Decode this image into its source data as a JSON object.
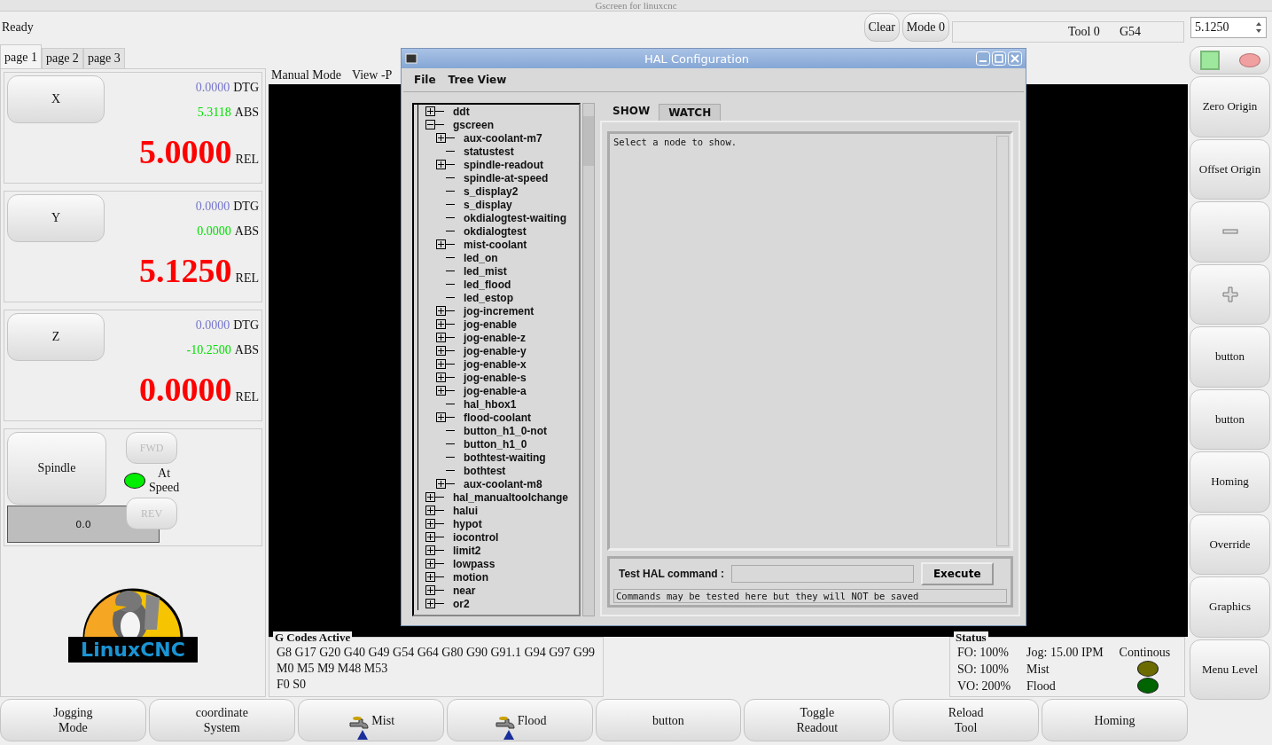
{
  "window": {
    "title": "Gscreen for linuxcnc"
  },
  "top_bar": {
    "status": "Ready",
    "buttons": [
      "Clear",
      "Mode 0"
    ],
    "tool": "Tool 0",
    "offset": "G54",
    "spin_value": "5.1250"
  },
  "tabs": [
    {
      "label": "page 1",
      "selected": true
    },
    {
      "label": "page 2",
      "selected": false
    },
    {
      "label": "page 3",
      "selected": false
    }
  ],
  "axes": [
    {
      "name": "X",
      "dtg": "0.0000",
      "dtg_label": "DTG",
      "abs": "5.3118",
      "abs_label": "ABS",
      "rel": "5.0000",
      "rel_label": "REL"
    },
    {
      "name": "Y",
      "dtg": "0.0000",
      "dtg_label": "DTG",
      "abs": "0.0000",
      "abs_label": "ABS",
      "rel": "5.1250",
      "rel_label": "REL"
    },
    {
      "name": "Z",
      "dtg": "0.0000",
      "dtg_label": "DTG",
      "abs": "-10.2500",
      "abs_label": "ABS",
      "rel": "0.0000",
      "rel_label": "REL"
    }
  ],
  "spindle": {
    "button": "Spindle",
    "fwd": {
      "label": "FWD",
      "disabled": true
    },
    "rev": {
      "label": "REV",
      "disabled": true
    },
    "at_speed_label": "At\nSpeed",
    "at_speed_led": {
      "color": "#00ee00"
    },
    "speed": "0.0"
  },
  "logo": {
    "text": "LinuxCNC"
  },
  "center": {
    "mode": "Manual Mode",
    "view": "View -P"
  },
  "gcodes": {
    "title": "G Codes Active",
    "lines": [
      "G8 G17 G20 G40 G49 G54 G64 G80 G90 G91.1 G94 G97 G99",
      "M0 M5 M9 M48 M53",
      "F0    S0"
    ]
  },
  "status": {
    "title": "Status",
    "fo": "FO: 100%",
    "jog": "Jog: 15.00 IPM",
    "jog_mode": "Continous",
    "so": "SO: 100%",
    "vo": "VO: 200%",
    "leds": [
      {
        "label": "Mist",
        "color": "#6b6b00"
      },
      {
        "label": "Flood",
        "color": "#006400"
      }
    ]
  },
  "right_buttons": [
    {
      "kind": "leds"
    },
    {
      "kind": "text",
      "label": "Zero Origin"
    },
    {
      "kind": "text",
      "label": "Offset Origin"
    },
    {
      "kind": "minus"
    },
    {
      "kind": "plus"
    },
    {
      "kind": "text",
      "label": "button"
    },
    {
      "kind": "text",
      "label": "button"
    },
    {
      "kind": "text",
      "label": "Homing"
    },
    {
      "kind": "text",
      "label": "Override"
    },
    {
      "kind": "text",
      "label": "Graphics"
    },
    {
      "kind": "text",
      "label": "Menu Level"
    }
  ],
  "bottom_buttons": [
    {
      "kind": "text",
      "label": "Jogging\nMode"
    },
    {
      "kind": "text",
      "label": "coordinate\nSystem"
    },
    {
      "kind": "tap",
      "label": "Mist"
    },
    {
      "kind": "tap",
      "label": "Flood"
    },
    {
      "kind": "text",
      "label": "button"
    },
    {
      "kind": "text",
      "label": "Toggle\nReadout"
    },
    {
      "kind": "text",
      "label": "Reload\nTool"
    },
    {
      "kind": "text",
      "label": "Homing"
    }
  ],
  "hal_dialog": {
    "title": "HAL Configuration",
    "menu": [
      "File",
      "Tree View"
    ],
    "tree": [
      {
        "label": "ddt",
        "kind": "branch",
        "expanded": false
      },
      {
        "label": "gscreen",
        "kind": "branch",
        "expanded": true,
        "children": [
          {
            "label": "aux-coolant-m7",
            "kind": "branch",
            "expanded": false
          },
          {
            "label": "statustest",
            "kind": "leaf"
          },
          {
            "label": "spindle-readout",
            "kind": "branch",
            "expanded": false
          },
          {
            "label": "spindle-at-speed",
            "kind": "leaf"
          },
          {
            "label": "s_display2",
            "kind": "leaf"
          },
          {
            "label": "s_display",
            "kind": "leaf"
          },
          {
            "label": "okdialogtest-waiting",
            "kind": "leaf"
          },
          {
            "label": "okdialogtest",
            "kind": "leaf"
          },
          {
            "label": "mist-coolant",
            "kind": "branch",
            "expanded": false
          },
          {
            "label": "led_on",
            "kind": "leaf"
          },
          {
            "label": "led_mist",
            "kind": "leaf"
          },
          {
            "label": "led_flood",
            "kind": "leaf"
          },
          {
            "label": "led_estop",
            "kind": "leaf"
          },
          {
            "label": "jog-increment",
            "kind": "branch",
            "expanded": false
          },
          {
            "label": "jog-enable",
            "kind": "branch",
            "expanded": false
          },
          {
            "label": "jog-enable-z",
            "kind": "branch",
            "expanded": false
          },
          {
            "label": "jog-enable-y",
            "kind": "branch",
            "expanded": false
          },
          {
            "label": "jog-enable-x",
            "kind": "branch",
            "expanded": false
          },
          {
            "label": "jog-enable-s",
            "kind": "branch",
            "expanded": false
          },
          {
            "label": "jog-enable-a",
            "kind": "branch",
            "expanded": false
          },
          {
            "label": "hal_hbox1",
            "kind": "leaf"
          },
          {
            "label": "flood-coolant",
            "kind": "branch",
            "expanded": false
          },
          {
            "label": "button_h1_0-not",
            "kind": "leaf"
          },
          {
            "label": "button_h1_0",
            "kind": "leaf"
          },
          {
            "label": "bothtest-waiting",
            "kind": "leaf"
          },
          {
            "label": "bothtest",
            "kind": "leaf"
          },
          {
            "label": "aux-coolant-m8",
            "kind": "branch",
            "expanded": false
          }
        ]
      },
      {
        "label": "hal_manualtoolchange",
        "kind": "branch",
        "expanded": false
      },
      {
        "label": "halui",
        "kind": "branch",
        "expanded": false
      },
      {
        "label": "hypot",
        "kind": "branch",
        "expanded": false
      },
      {
        "label": "iocontrol",
        "kind": "branch",
        "expanded": false
      },
      {
        "label": "limit2",
        "kind": "branch",
        "expanded": false
      },
      {
        "label": "lowpass",
        "kind": "branch",
        "expanded": false
      },
      {
        "label": "motion",
        "kind": "branch",
        "expanded": false
      },
      {
        "label": "near",
        "kind": "branch",
        "expanded": false
      },
      {
        "label": "or2",
        "kind": "branch",
        "expanded": false
      }
    ],
    "tabs": [
      {
        "label": "SHOW",
        "selected": true
      },
      {
        "label": "WATCH",
        "selected": false
      }
    ],
    "show_text": "Select a node to show.",
    "command_label": "Test HAL command :",
    "execute": "Execute",
    "note": "Commands may be tested here but they will NOT be saved"
  }
}
